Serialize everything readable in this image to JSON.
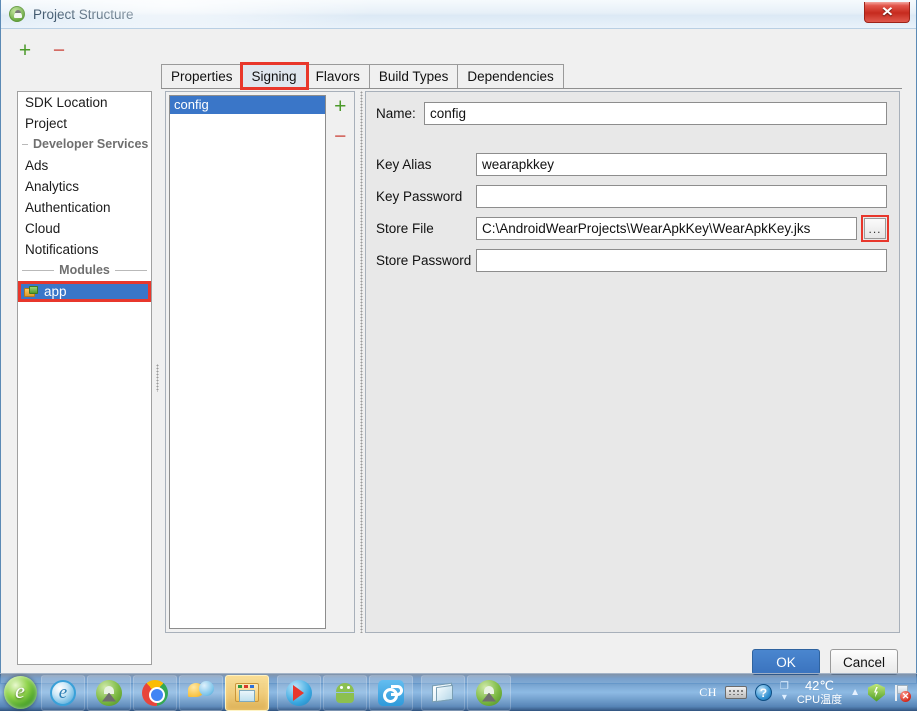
{
  "window": {
    "title": "Project Structure",
    "icon": "android-studio-icon",
    "close_label": "✕"
  },
  "toolbar": {
    "add_label": "+",
    "remove_label": "−"
  },
  "sidebar": {
    "items": [
      {
        "type": "item",
        "label": "SDK Location",
        "selected": false
      },
      {
        "type": "item",
        "label": "Project",
        "selected": false
      },
      {
        "type": "separator",
        "label": "Developer Services"
      },
      {
        "type": "item",
        "label": "Ads",
        "selected": false
      },
      {
        "type": "item",
        "label": "Analytics",
        "selected": false
      },
      {
        "type": "item",
        "label": "Authentication",
        "selected": false
      },
      {
        "type": "item",
        "label": "Cloud",
        "selected": false
      },
      {
        "type": "item",
        "label": "Notifications",
        "selected": false
      },
      {
        "type": "separator",
        "label": "Modules"
      },
      {
        "type": "module",
        "label": "app",
        "selected": true
      }
    ]
  },
  "tabs": [
    {
      "label": "Properties",
      "selected": false
    },
    {
      "label": "Signing",
      "selected": true
    },
    {
      "label": "Flavors",
      "selected": false
    },
    {
      "label": "Build Types",
      "selected": false
    },
    {
      "label": "Dependencies",
      "selected": false
    }
  ],
  "config_list": {
    "items": [
      {
        "label": "config",
        "selected": true
      }
    ],
    "add_label": "+",
    "remove_label": "−"
  },
  "form": {
    "name": {
      "label": "Name:",
      "value": "config",
      "placeholder": ""
    },
    "key_alias": {
      "label": "Key Alias",
      "value": "wearapkkey",
      "placeholder": ""
    },
    "key_password": {
      "label": "Key Password",
      "value": "",
      "placeholder": ""
    },
    "store_file": {
      "label": "Store File",
      "value": "C:\\AndroidWearProjects\\WearApkKey\\WearApkKey.jks",
      "placeholder": "",
      "browse_label": "..."
    },
    "store_password": {
      "label": "Store Password",
      "value": "",
      "placeholder": ""
    }
  },
  "dialog_buttons": {
    "ok": "OK",
    "cancel": "Cancel"
  },
  "taskbar": {
    "start": "start-orb",
    "items": [
      {
        "name": "internet-explorer",
        "icon": "ie-icon",
        "active": false
      },
      {
        "name": "android-studio",
        "icon": "android-studio-icon",
        "active": false
      },
      {
        "name": "google-chrome",
        "icon": "chrome-icon",
        "active": false
      },
      {
        "name": "qq-messenger",
        "icon": "chat-bubbles-icon",
        "active": false
      },
      {
        "name": "file-explorer",
        "icon": "folder-icon",
        "active": true
      },
      {
        "name": "media-player",
        "icon": "play-icon",
        "active": false
      },
      {
        "name": "android-emulator",
        "icon": "android-robot-icon",
        "active": false
      },
      {
        "name": "blue-app",
        "icon": "link-icon",
        "active": false
      },
      {
        "name": "notepad",
        "icon": "notepad-icon",
        "active": false
      },
      {
        "name": "android-studio-window",
        "icon": "android-studio-icon",
        "active": false
      }
    ],
    "tray": {
      "ime": "CH",
      "keyboard_icon": "keyboard-icon",
      "help_icon": "help-icon",
      "cpu_temp": "42℃",
      "cpu_label": "CPU温度",
      "chevron": "▲",
      "shield_icon": "shield-icon",
      "flag_icon": "flag-error-icon",
      "flag_badge": "✕"
    }
  },
  "highlights": {
    "accent_red": "#e8372c",
    "selection_blue": "#3a76c8"
  }
}
